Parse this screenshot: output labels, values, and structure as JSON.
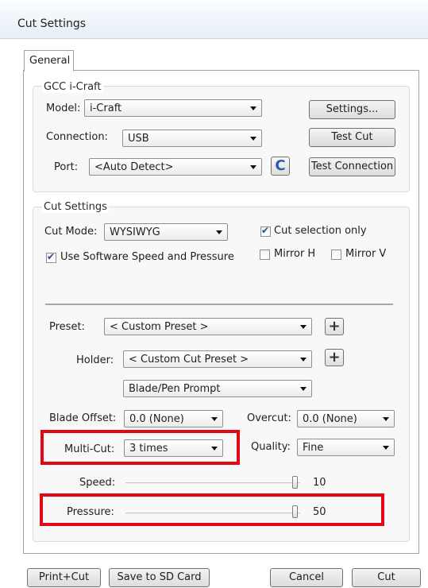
{
  "window": {
    "title": "Cut Settings"
  },
  "tabs": [
    {
      "label": "General"
    }
  ],
  "gcc_group": {
    "title": "GCC i-Craft",
    "model_label": "Model:",
    "model_value": "i-Craft",
    "connection_label": "Connection:",
    "connection_value": "USB",
    "port_label": "Port:",
    "port_value": "<Auto Detect>",
    "settings_button": "Settings...",
    "test_cut_button": "Test Cut",
    "test_connection_button": "Test Connection",
    "refresh_glyph": "C"
  },
  "cut_group": {
    "title": "Cut Settings",
    "cut_mode_label": "Cut Mode:",
    "cut_mode_value": "WYSIWYG",
    "cut_selection_only": {
      "label": "Cut selection only",
      "checked": true
    },
    "use_software_speed": {
      "label": "Use Software Speed and Pressure",
      "checked": true
    },
    "mirror_h": {
      "label": "Mirror H",
      "checked": false
    },
    "mirror_v": {
      "label": "Mirror V",
      "checked": false
    },
    "preset_label": "Preset:",
    "preset_value": "< Custom Preset >",
    "holder_label": "Holder:",
    "holder_value": "< Custom Cut Preset >",
    "blade_prompt_value": "Blade/Pen Prompt",
    "blade_offset_label": "Blade Offset:",
    "blade_offset_value": "0.0 (None)",
    "overcut_label": "Overcut:",
    "overcut_value": "0.0 (None)",
    "multicut_label": "Multi-Cut:",
    "multicut_value": "3 times",
    "quality_label": "Quality:",
    "quality_value": "Fine",
    "speed_label": "Speed:",
    "speed_value": "10",
    "pressure_label": "Pressure:",
    "pressure_value": "50",
    "plus_glyph": "+"
  },
  "footer": {
    "print_cut": "Print+Cut",
    "save_sd": "Save to SD Card",
    "cancel": "Cancel",
    "cut": "Cut"
  },
  "colors": {
    "highlight": "#e30613",
    "refresh_icon": "#2a5ea8"
  },
  "icons": {
    "dropdown": "chevron-down-icon",
    "refresh": "refresh-icon",
    "add": "plus-icon",
    "check": "checkmark-icon"
  }
}
